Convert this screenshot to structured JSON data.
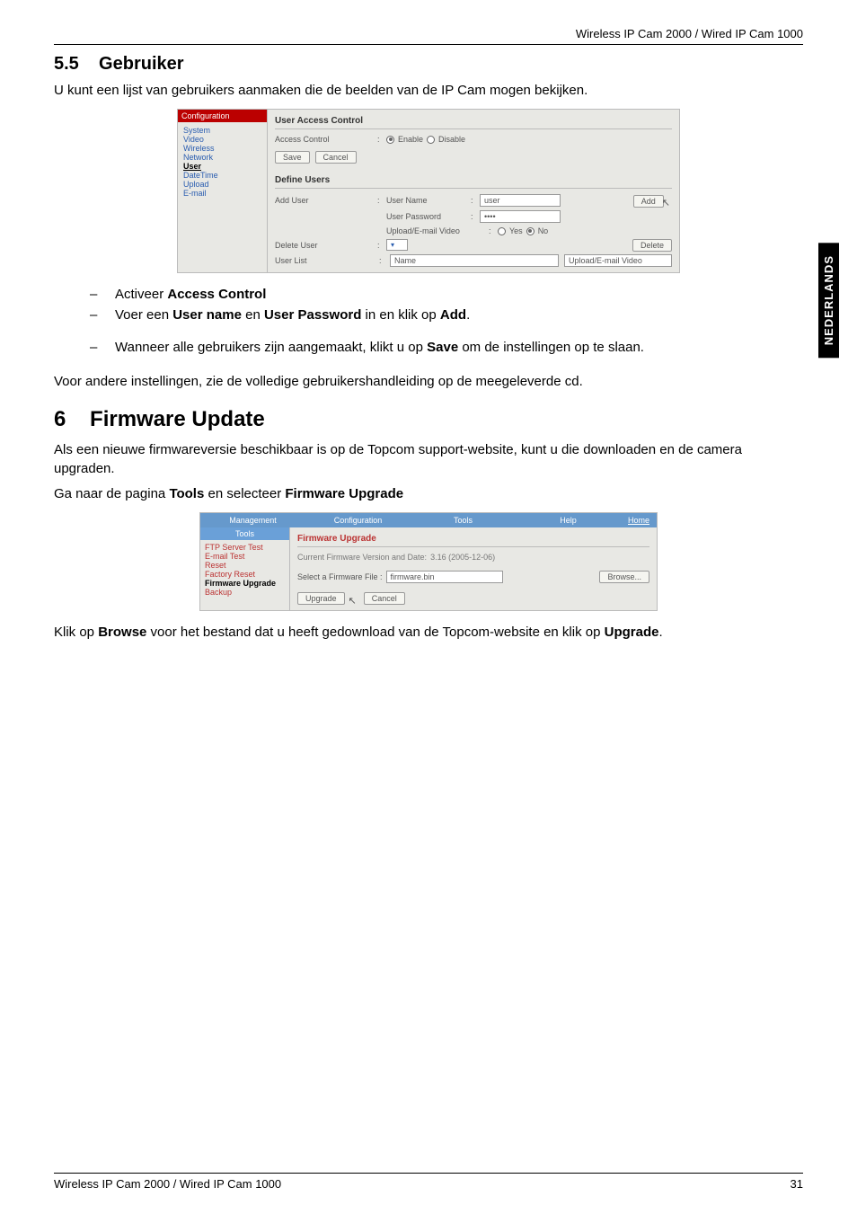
{
  "header": {
    "product": "Wireless IP Cam 2000 / Wired IP Cam 1000"
  },
  "side_tab": "NEDERLANDS",
  "s55": {
    "num": "5.5",
    "title": "Gebruiker",
    "intro": "U kunt een lijst van gebruikers aanmaken die de beelden van de IP Cam mogen bekijken."
  },
  "shot1": {
    "nav_title": "Configuration",
    "nav_items": [
      "System",
      "Video",
      "Wireless",
      "Network",
      "User",
      "DateTime",
      "Upload",
      "E-mail"
    ],
    "nav_current": "User",
    "sec1": "User Access Control",
    "access_label": "Access Control",
    "enable": "Enable",
    "disable": "Disable",
    "save": "Save",
    "cancel": "Cancel",
    "sec2": "Define Users",
    "adduser": "Add User",
    "uname": "User Name",
    "uname_val": "user",
    "upass": "User Password",
    "upass_val": "••••",
    "uev": "Upload/E-mail Video",
    "yes": "Yes",
    "no": "No",
    "add": "Add",
    "deluser": "Delete User",
    "delete": "Delete",
    "userlist": "User List",
    "listcols_name": "Name",
    "listcols_uev": "Upload/E-mail Video"
  },
  "bullets55": {
    "b1_pre": "Activeer ",
    "b1_bold": "Access Control",
    "b2_a": "Voer een ",
    "b2_b1": "User name",
    "b2_c": " en ",
    "b2_b2": "User Password",
    "b2_d": " in en klik op ",
    "b2_b3": "Add",
    "b2_e": ".",
    "b3_a": "Wanneer alle gebruikers zijn aangemaakt, klikt u op ",
    "b3_b": "Save",
    "b3_c": "  om de instellingen op te slaan."
  },
  "outro55": "Voor andere instellingen, zie de volledige gebruikershandleiding op de meegeleverde cd.",
  "s6": {
    "num": "6",
    "title": "Firmware Update",
    "p1": "Als een nieuwe firmwareversie beschikbaar is op de Topcom support-website, kunt u die downloaden en de camera upgraden.",
    "p2_a": "Ga naar de pagina ",
    "p2_b1": "Tools",
    "p2_b": " en selecteer ",
    "p2_b2": "Firmware Upgrade"
  },
  "shot2": {
    "tabs": [
      "Management",
      "Configuration",
      "Tools",
      "Help"
    ],
    "home": "Home",
    "nav_title": "Tools",
    "nav_items": [
      "FTP Server Test",
      "E-mail Test",
      "Reset",
      "Factory Reset",
      "Firmware Upgrade",
      "Backup"
    ],
    "nav_current": "Firmware Upgrade",
    "sec": "Firmware Upgrade",
    "line1_a": "Current Firmware Version and Date: ",
    "line1_b": "3.16 (2005-12-06)",
    "line2_a": "Select a Firmware File : ",
    "line2_b": "firmware.bin",
    "browse": "Browse...",
    "upgrade": "Upgrade",
    "cancel": "Cancel"
  },
  "p6_final": {
    "a": "Klik op ",
    "b1": "Browse",
    "b": " voor het bestand dat u heeft gedownload van de Topcom-website en klik op ",
    "b2": "Upgrade",
    "c": "."
  },
  "footer": {
    "left": "Wireless IP Cam 2000 / Wired IP Cam 1000",
    "right": "31"
  }
}
